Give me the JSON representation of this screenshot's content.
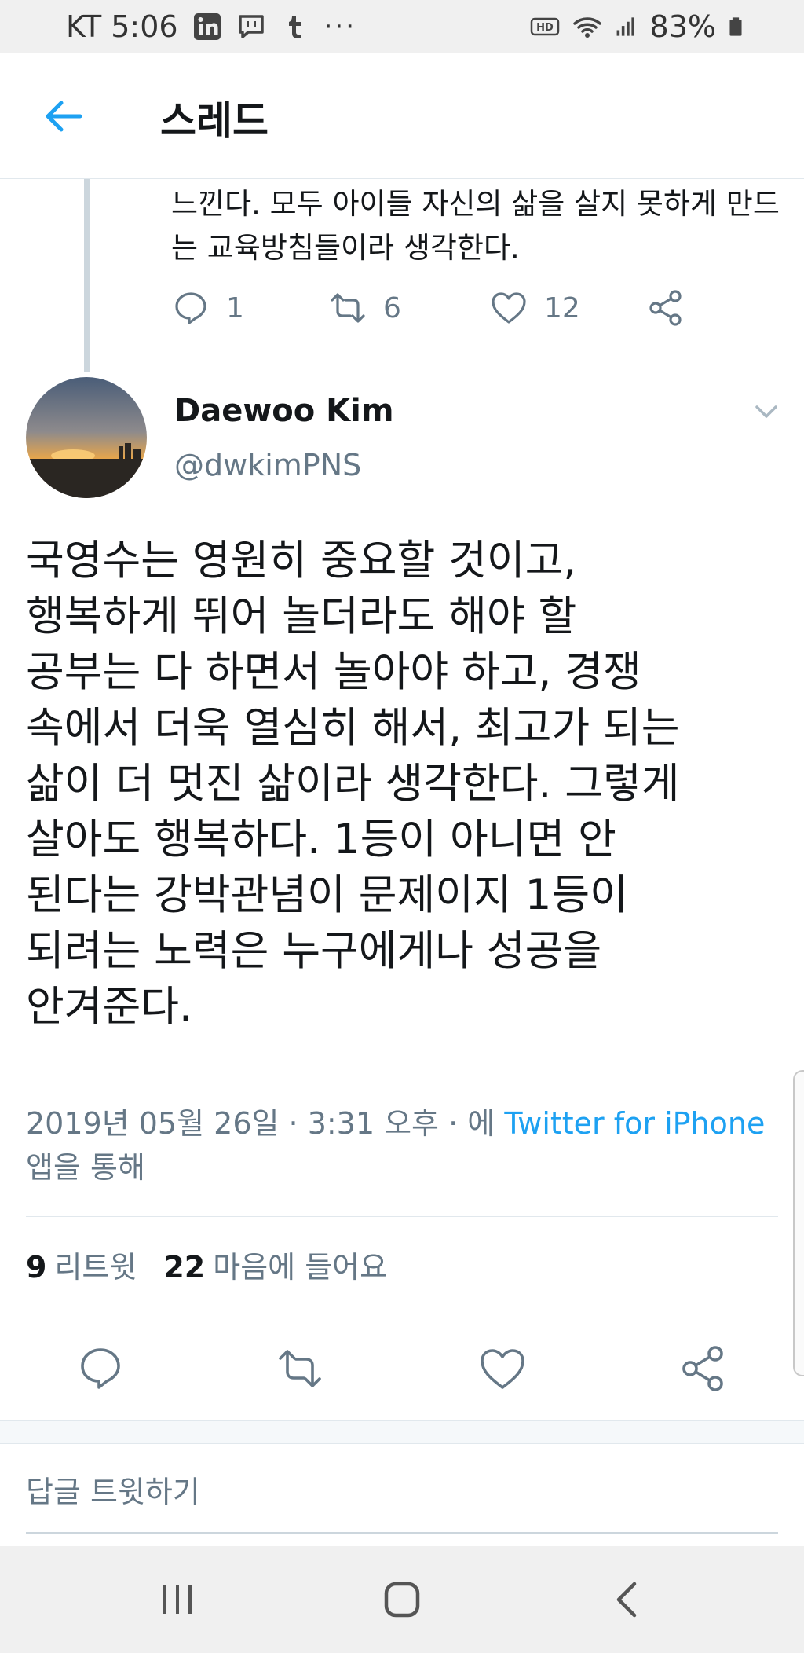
{
  "status_bar": {
    "carrier_time": "KT 5:06",
    "battery": "83%",
    "icons": [
      "linkedin-icon",
      "message-icon",
      "tumblr-icon",
      "more-icon",
      "hd-icon",
      "wifi-icon",
      "signal-icon",
      "battery-icon"
    ]
  },
  "header": {
    "title": "스레드",
    "back_icon": "arrow-left-icon"
  },
  "previous_tweet": {
    "text": "느낀다. 모두 아이들 자신의 삶을 살지 못하게 만드는 교육방침들이라 생각한다.",
    "reply_count": "1",
    "retweet_count": "6",
    "like_count": "12"
  },
  "tweet": {
    "author_name": "Daewoo Kim",
    "author_handle": "@dwkimPNS",
    "text": "국영수는 영원히 중요할 것이고,\n행복하게 뛰어 놀더라도 해야 할\n공부는 다 하면서 놀아야 하고, 경쟁\n속에서 더욱 열심히 해서, 최고가 되는\n삶이 더 멋진 삶이라 생각한다. 그렇게\n살아도 행복하다. 1등이 아니면 안\n된다는 강박관념이 문제이지 1등이\n되려는 노력은 누구에게나 성공을\n안겨준다.",
    "date_time": "2019년 05월 26일 · 3:31 오후 · 에 ",
    "source_link": "Twitter for iPhone",
    "source_suffix": "앱을 통해",
    "retweets_count": "9",
    "retweets_label": "리트윗",
    "likes_count": "22",
    "likes_label": "마음에 들어요"
  },
  "reply_box": {
    "placeholder": "답글 트윗하기"
  },
  "colors": {
    "accent": "#1da1f2",
    "secondary_text": "#657786",
    "primary_text": "#14171a",
    "divider": "#e1e8ed"
  }
}
